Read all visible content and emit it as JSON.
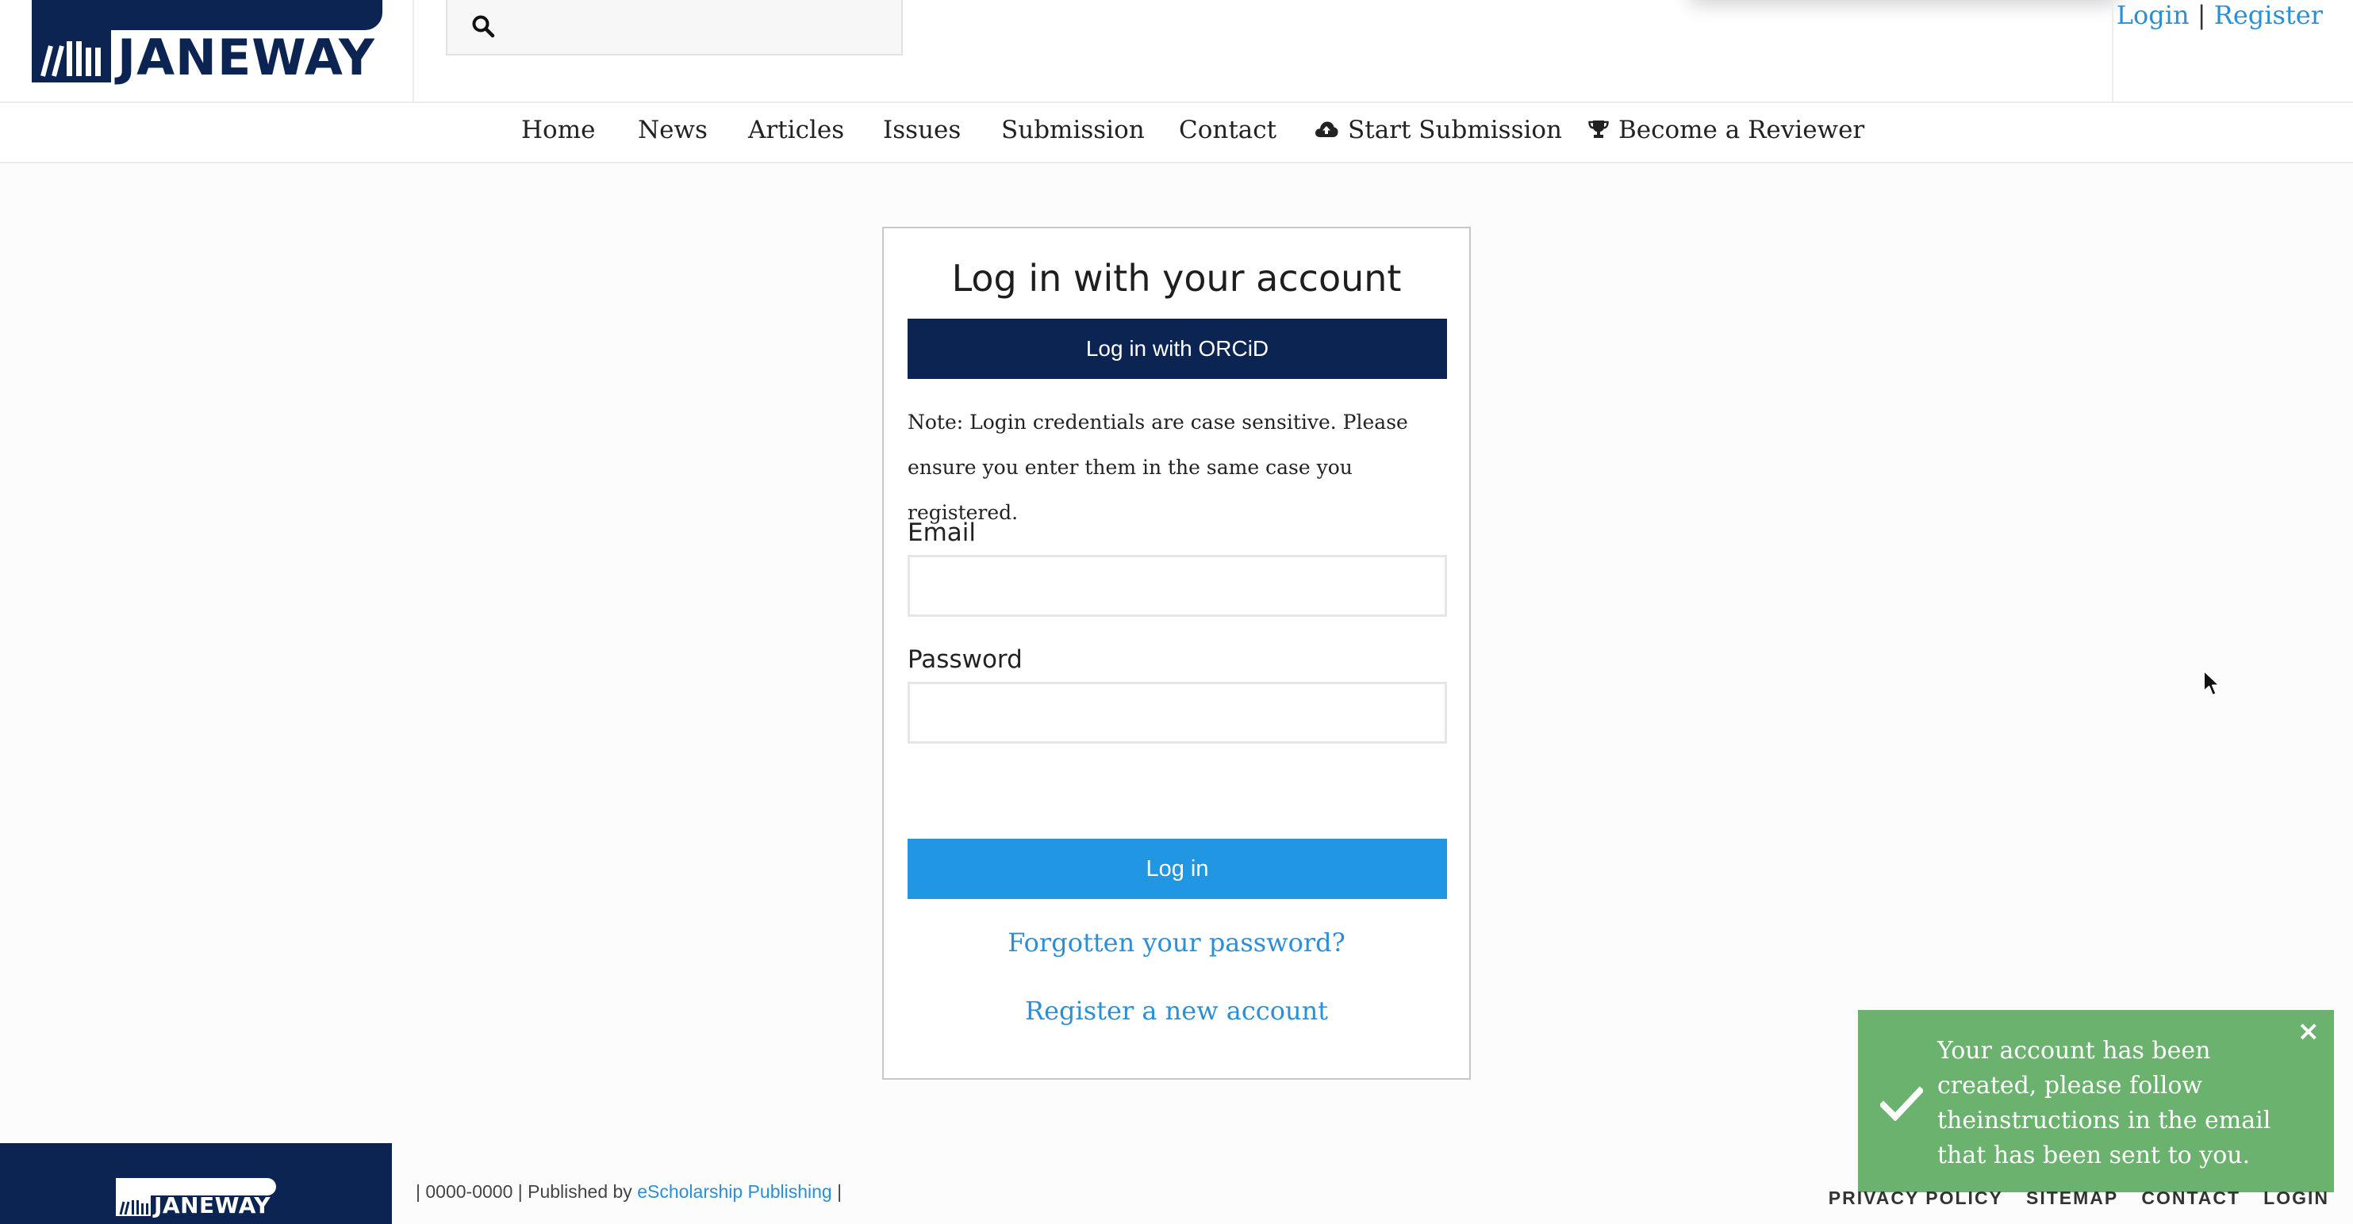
{
  "header": {
    "logo_text": "JANEWAY",
    "search": {
      "placeholder": ""
    },
    "auth": {
      "login": "Login",
      "separator": "|",
      "register": "Register"
    }
  },
  "nav": {
    "items": [
      "Home",
      "News",
      "Articles",
      "Issues",
      "Submission",
      "Contact"
    ],
    "start_submission": "Start Submission",
    "become_reviewer": "Become a Reviewer"
  },
  "login_form": {
    "title": "Log in with your account",
    "orcid_button": "Log in with ORCiD",
    "note": "Note: Login credentials are case sensitive. Please ensure you enter them in the same case you registered.",
    "email_label": "Email",
    "email_value": "",
    "password_label": "Password",
    "password_value": "",
    "login_button": "Log in",
    "forgot_link": "Forgotten your password?",
    "register_link": "Register a new account"
  },
  "toast": {
    "message": "Your account has been created, please follow theinstructions in the email that has been sent to you.",
    "close": "×"
  },
  "footer": {
    "logo_text": "JANEWAY",
    "info_prefix": "| 0000-0000 | Published by",
    "publisher": "eScholarship Publishing",
    "info_suffix": "|",
    "links": [
      "PRIVACY POLICY",
      "SITEMAP",
      "CONTACT",
      "LOGIN"
    ]
  },
  "colors": {
    "brand_navy": "#0b2452",
    "primary_blue": "#2196e3",
    "link_blue": "#2a8fd6",
    "toast_green": "#6bb26f"
  },
  "icons": [
    "search-icon",
    "cloud-upload-icon",
    "trophy-icon",
    "check-icon",
    "close-icon",
    "mouse-cursor-icon"
  ]
}
